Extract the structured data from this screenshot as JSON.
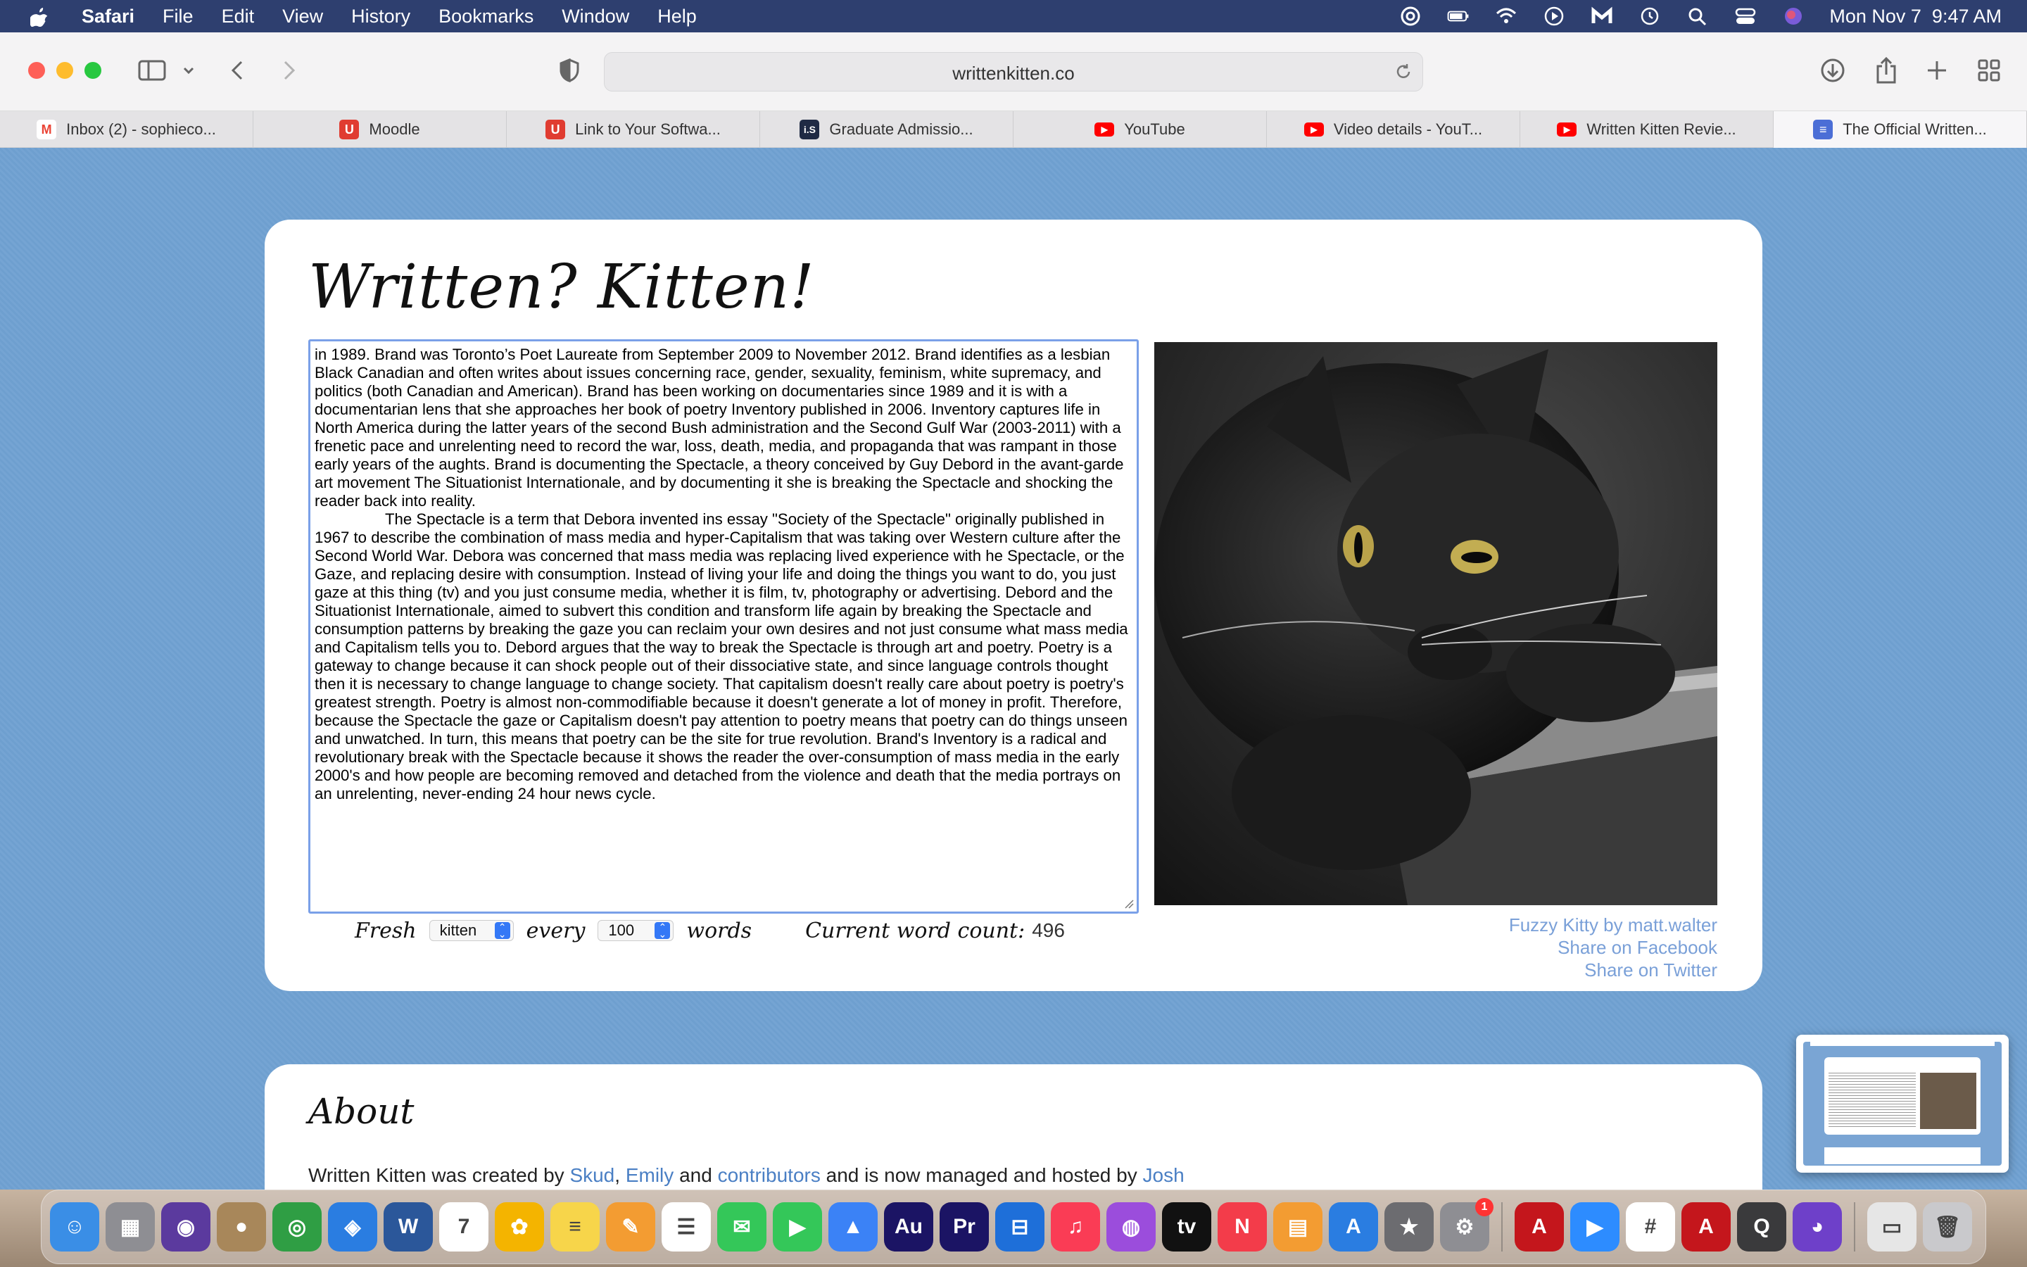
{
  "menubar": {
    "app_name": "Safari",
    "menus": [
      "File",
      "Edit",
      "View",
      "History",
      "Bookmarks",
      "Window",
      "Help"
    ],
    "clock": "Mon Nov 7  9:47 AM"
  },
  "browser": {
    "url": "writtenkitten.co",
    "tabs": [
      {
        "label": "Inbox (2) - sophieco...",
        "icon": "gmail-icon",
        "color": "#ea4335",
        "glyph": "M"
      },
      {
        "label": "Moodle",
        "icon": "moodle-icon",
        "color": "#e03c31",
        "glyph": "U"
      },
      {
        "label": "Link to Your Softwa...",
        "icon": "moodle-icon",
        "color": "#e03c31",
        "glyph": "U"
      },
      {
        "label": "Graduate Admissio...",
        "icon": "is-icon",
        "color": "#1f2a44",
        "glyph": "i.S"
      },
      {
        "label": "YouTube",
        "icon": "youtube-icon",
        "color": "#ff0000",
        "glyph": "▶"
      },
      {
        "label": "Video details - YouT...",
        "icon": "youtube-icon",
        "color": "#ff0000",
        "glyph": "▶"
      },
      {
        "label": "Written Kitten Revie...",
        "icon": "youtube-icon",
        "color": "#ff0000",
        "glyph": "▶"
      },
      {
        "label": "The Official Written...",
        "icon": "docs-icon",
        "color": "#4b6ed6",
        "glyph": "≡"
      }
    ]
  },
  "site": {
    "title": "Written? Kitten!",
    "editor_paragraphs": [
      "in 1989. Brand was Toronto’s Poet Laureate from September 2009 to November 2012. Brand identifies as a lesbian Black Canadian and often writes about issues concerning race, gender, sexuality, feminism, white supremacy, and politics (both Canadian and American). Brand has been working on documentaries since 1989 and it is with a documentarian lens that she approaches her book of poetry Inventory published in 2006. Inventory captures life in North America during the latter years of the second Bush administration and the Second Gulf War (2003-2011) with a frenetic pace and unrelenting need to record the war, loss, death, media, and propaganda that was rampant in those early years of the aughts. Brand is documenting the Spectacle, a theory conceived by Guy Debord in the avant-garde art movement The Situationist Internationale, and by documenting it she is breaking the Spectacle and shocking the reader back into reality.",
      "The Spectacle is a term that Debora invented ins essay \"Society of the Spectacle\" originally published in 1967 to describe the combination of mass media and hyper-Capitalism that was taking over Western culture after the Second World War. Debora was concerned that mass media was replacing lived experience with he Spectacle, or the Gaze, and replacing desire with consumption. Instead of living your life and doing the things you want to do, you just gaze at this thing (tv) and you just consume media, whether it is film, tv, photography or advertising. Debord and the Situationist Internationale, aimed to subvert this condition and transform life again by breaking the Spectacle and consumption patterns by breaking the gaze you can reclaim your own desires and not just consume what mass media and Capitalism tells you to. Debord argues that the way to break the Spectacle is through art and poetry. Poetry is a gateway to change because it can shock people out of their dissociative state, and since language controls thought then it is necessary to change language to change society. That capitalism doesn't really care about poetry is poetry's greatest strength. Poetry is almost non-commodifiable because it doesn't generate a lot of money in profit. Therefore, because the Spectacle the gaze or Capitalism doesn't pay attention to poetry means that poetry can do things unseen and unwatched. In turn, this means that poetry can be the site for true revolution. Brand's Inventory is a radical and revolutionary break with the Spectacle because it shows the reader the over-consumption of mass media in the early 2000's and how people are becoming removed and detached from the violence and death that the media portrays on an unrelenting, never-ending 24 hour news cycle."
    ],
    "controls": {
      "fresh_label": "Fresh",
      "animal_value": "kitten",
      "every_label": "every",
      "words_value": "100",
      "words_label": "words",
      "count_label": "Current word count:",
      "count_value": "496"
    },
    "photo_links": {
      "credit": "Fuzzy Kitty by matt.walter",
      "facebook": "Share on Facebook",
      "twitter": "Share on Twitter"
    },
    "about": {
      "title": "About",
      "text_before": "Written Kitten was created by",
      "link_skud": "Skud",
      "sep1": ",",
      "link_emily": "Emily",
      "text_and": "and",
      "link_contributors": "contributors",
      "text_after": "and is now managed and hosted by",
      "link_josh": "Josh"
    }
  },
  "dock": {
    "apps": [
      {
        "name": "finder-icon",
        "color": "#3a8ee6",
        "glyph": "☺"
      },
      {
        "name": "launchpad-icon",
        "color": "#8e8e93",
        "glyph": "▦"
      },
      {
        "name": "siri-icon",
        "color": "#5b3a9e",
        "glyph": "◉"
      },
      {
        "name": "contacts-icon",
        "color": "#a8875a",
        "glyph": "●"
      },
      {
        "name": "chrome-icon",
        "color": "#2f9e44",
        "glyph": "◎"
      },
      {
        "name": "safari-icon",
        "color": "#2a7de1",
        "glyph": "◈"
      },
      {
        "name": "word-icon",
        "color": "#2b579a",
        "glyph": "W"
      },
      {
        "name": "calendar-icon",
        "color": "#ffffff",
        "glyph": "7"
      },
      {
        "name": "photos-icon",
        "color": "#f4b400",
        "glyph": "✿"
      },
      {
        "name": "notes-icon",
        "color": "#f7d54a",
        "glyph": "≡"
      },
      {
        "name": "pages-icon",
        "color": "#f39c32",
        "glyph": "✎"
      },
      {
        "name": "reminders-icon",
        "color": "#ffffff",
        "glyph": "☰"
      },
      {
        "name": "messages-icon",
        "color": "#34c759",
        "glyph": "✉"
      },
      {
        "name": "facetime-icon",
        "color": "#34c759",
        "glyph": "▶"
      },
      {
        "name": "keynote-icon",
        "color": "#3b82f6",
        "glyph": "▲"
      },
      {
        "name": "audition-icon",
        "color": "#1b1464",
        "glyph": "Au"
      },
      {
        "name": "premiere-icon",
        "color": "#1b1464",
        "glyph": "Pr"
      },
      {
        "name": "capcut-icon",
        "color": "#1e6fd9",
        "glyph": "⊟"
      },
      {
        "name": "music-icon",
        "color": "#fa3c55",
        "glyph": "♫"
      },
      {
        "name": "podcasts-icon",
        "color": "#9b4ddc",
        "glyph": "◍"
      },
      {
        "name": "appletv-icon",
        "color": "#111111",
        "glyph": "tv"
      },
      {
        "name": "news-icon",
        "color": "#f33c4a",
        "glyph": "N"
      },
      {
        "name": "books-icon",
        "color": "#f39c32",
        "glyph": "▤"
      },
      {
        "name": "appstore-icon",
        "color": "#2a7de1",
        "glyph": "A"
      },
      {
        "name": "imovie-icon",
        "color": "#6c6c70",
        "glyph": "★"
      },
      {
        "name": "system-preferences-icon",
        "color": "#8e8e93",
        "glyph": "⚙",
        "badge": "1"
      },
      {
        "name": "acrobat-icon",
        "color": "#c4161c",
        "glyph": "A"
      },
      {
        "name": "zoom-icon",
        "color": "#2d8cff",
        "glyph": "▶"
      },
      {
        "name": "slack-icon",
        "color": "#ffffff",
        "glyph": "#"
      },
      {
        "name": "acrobat-reader-icon",
        "color": "#c4161c",
        "glyph": "A"
      },
      {
        "name": "quicktime-icon",
        "color": "#3a3a3c",
        "glyph": "Q"
      },
      {
        "name": "github-icon",
        "color": "#6e40c9",
        "glyph": "◕"
      },
      {
        "name": "preview-icon",
        "color": "#e6e6e6",
        "glyph": "▭"
      },
      {
        "name": "trash-icon",
        "color": "#c9c9cc",
        "glyph": "🗑"
      }
    ]
  }
}
